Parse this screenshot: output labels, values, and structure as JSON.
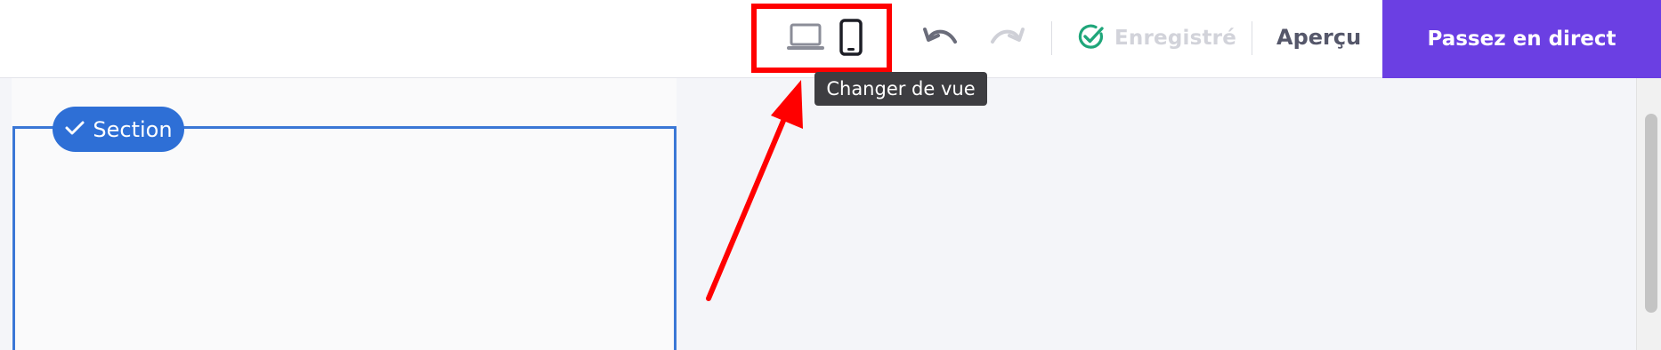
{
  "toolbar": {
    "view_toggle": {
      "desktop_icon": "laptop-icon",
      "mobile_icon": "smartphone-icon",
      "tooltip": "Changer de vue"
    },
    "undo_icon": "undo-icon",
    "redo_icon": "redo-icon",
    "saved_status": {
      "icon": "check-circle-icon",
      "label": "Enregistré"
    },
    "preview_label": "Aperçu",
    "publish_label": "Passez en direct"
  },
  "canvas": {
    "section_badge": {
      "icon": "check-icon",
      "label": "Section"
    }
  },
  "colors": {
    "accent": "#6b3fe3",
    "highlight": "#ff0000",
    "section": "#2e6fd6",
    "saved_check": "#1fa67a"
  }
}
